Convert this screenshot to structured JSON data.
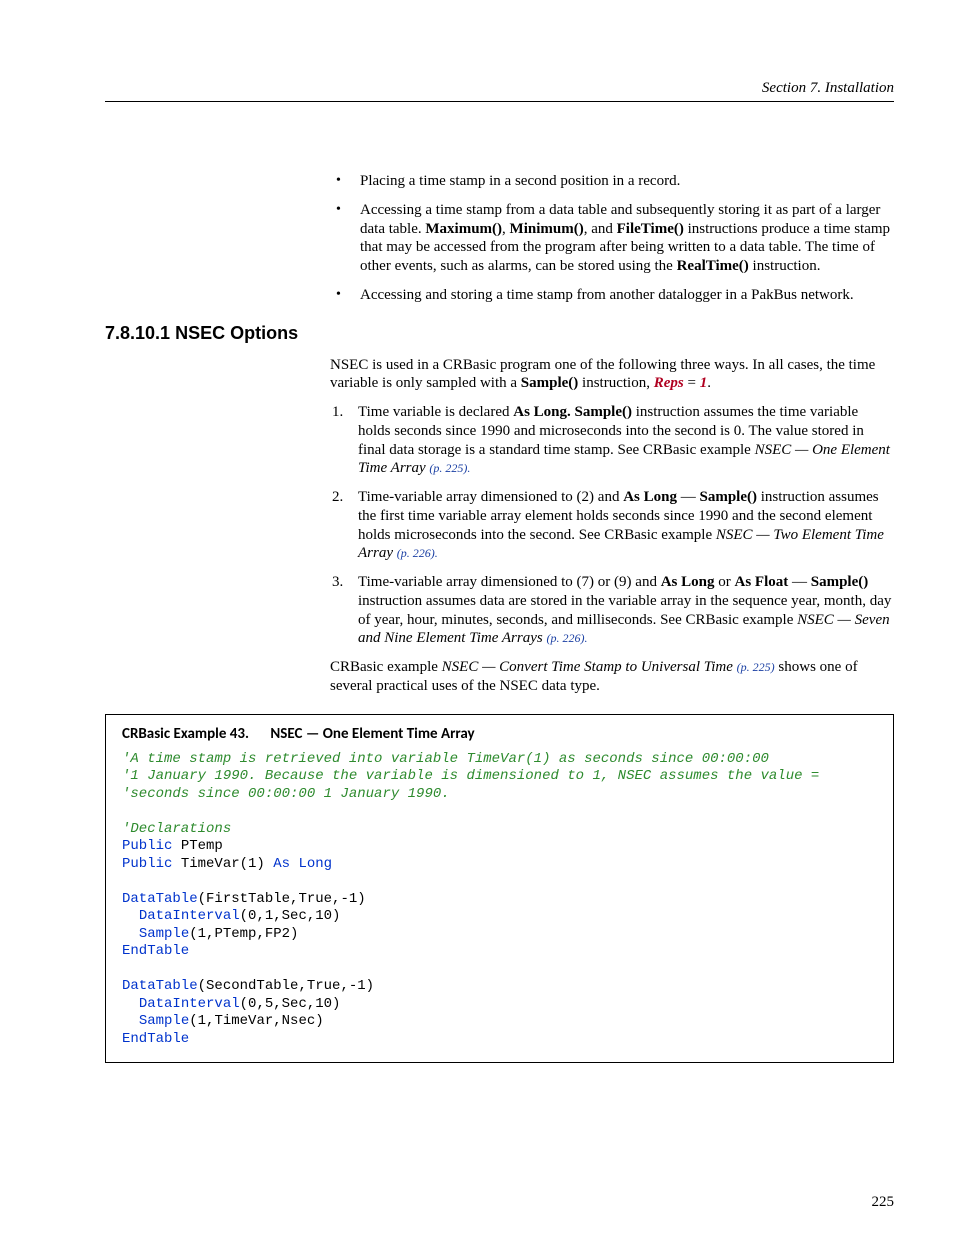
{
  "header": {
    "section_label": "Section 7.  Installation"
  },
  "bullets": [
    {
      "text": "Placing a time stamp in a second position in a record."
    },
    {
      "html": "Accessing a time stamp from a data table and subsequently storing it as part of a larger data table. <b>Maximum()</b>, <b>Minimum()</b>, and <b>FileTime()</b> instructions produce a time stamp that may be accessed from the program after being written to a data table. The time of other events, such as alarms, can be stored using the <b>RealTime()</b> instruction."
    },
    {
      "text": "Accessing and storing a time stamp from another datalogger in a PakBus network."
    }
  ],
  "heading": {
    "number": "7.8.10.1",
    "title": "NSEC Options"
  },
  "intro": {
    "lead": "NSEC is used in a CRBasic program one of the following three ways.  In all cases, the time variable is only sampled with a ",
    "sample_b": "Sample()",
    "mid": " instruction, ",
    "reps": "Reps",
    "eq": " = ",
    "one": "1",
    "tail": "."
  },
  "numlist": [
    {
      "pre": "Time variable is declared ",
      "b1": "As Long.  Sample()",
      "mid": " instruction assumes the time variable holds seconds since 1990 and microseconds into the second is 0.  The value stored in final data storage is a standard time stamp.  See CRBasic example ",
      "em": "NSEC — One Element Time Array ",
      "pref": "(p. 225)."
    },
    {
      "pre": "Time-variable array dimensioned to (2) and ",
      "b1": "As Long",
      "dash": " — ",
      "b2": "Sample()",
      "mid": " instruction assumes the first time variable array element holds seconds since 1990 and the second element holds microseconds into the second.  See CRBasic example ",
      "em": "NSEC — Two Element Time Array ",
      "pref": "(p. 226)."
    },
    {
      "pre": "Time-variable array dimensioned to (7) or (9) and ",
      "b1": "As Long",
      "or": " or ",
      "b2": "As Float",
      "dash": " — ",
      "b3": "Sample()",
      "mid": " instruction assumes data are stored in the variable array in the sequence year, month, day of year, hour, minutes, seconds, and milliseconds.  See CRBasic example ",
      "em": "NSEC — Seven and Nine Element Time Arrays ",
      "pref": "(p. 226)."
    }
  ],
  "closing": {
    "lead": "CRBasic example ",
    "em": "NSEC — Convert Time Stamp to Universal Time ",
    "pref": "(p. 225)",
    "tail": " shows one of several practical uses of the NSEC data type."
  },
  "example": {
    "label": "CRBasic Example 43.",
    "desc": "NSEC — One Element Time Array",
    "code": [
      {
        "cls": "c-comment",
        "t": "'A time stamp is retrieved into variable TimeVar(1) as seconds since 00:00:00"
      },
      {
        "cls": "c-comment",
        "t": "'1 January 1990. Because the variable is dimensioned to 1, NSEC assumes the value ="
      },
      {
        "cls": "c-comment",
        "t": "'seconds since 00:00:00 1 January 1990."
      },
      {
        "cls": "c-plain",
        "t": ""
      },
      {
        "cls": "c-comment",
        "t": "'Declarations"
      },
      {
        "mixed": [
          {
            "cls": "c-kw",
            "t": "Public"
          },
          {
            "cls": "c-plain",
            "t": " PTemp"
          }
        ]
      },
      {
        "mixed": [
          {
            "cls": "c-kw",
            "t": "Public"
          },
          {
            "cls": "c-plain",
            "t": " TimeVar(1) "
          },
          {
            "cls": "c-kw",
            "t": "As Long"
          }
        ]
      },
      {
        "cls": "c-plain",
        "t": ""
      },
      {
        "mixed": [
          {
            "cls": "c-kw",
            "t": "DataTable"
          },
          {
            "cls": "c-plain",
            "t": "(FirstTable,True,-1)"
          }
        ]
      },
      {
        "mixed": [
          {
            "cls": "c-plain",
            "t": "  "
          },
          {
            "cls": "c-kw",
            "t": "DataInterval"
          },
          {
            "cls": "c-plain",
            "t": "(0,1,Sec,10)"
          }
        ]
      },
      {
        "mixed": [
          {
            "cls": "c-plain",
            "t": "  "
          },
          {
            "cls": "c-kw",
            "t": "Sample"
          },
          {
            "cls": "c-plain",
            "t": "(1,PTemp,FP2)"
          }
        ]
      },
      {
        "cls": "c-kw",
        "t": "EndTable"
      },
      {
        "cls": "c-plain",
        "t": ""
      },
      {
        "mixed": [
          {
            "cls": "c-kw",
            "t": "DataTable"
          },
          {
            "cls": "c-plain",
            "t": "(SecondTable,True,-1)"
          }
        ]
      },
      {
        "mixed": [
          {
            "cls": "c-plain",
            "t": "  "
          },
          {
            "cls": "c-kw",
            "t": "DataInterval"
          },
          {
            "cls": "c-plain",
            "t": "(0,5,Sec,10)"
          }
        ]
      },
      {
        "mixed": [
          {
            "cls": "c-plain",
            "t": "  "
          },
          {
            "cls": "c-kw",
            "t": "Sample"
          },
          {
            "cls": "c-plain",
            "t": "(1,TimeVar,Nsec)"
          }
        ]
      },
      {
        "cls": "c-kw",
        "t": "EndTable"
      }
    ]
  },
  "page_number": "225"
}
